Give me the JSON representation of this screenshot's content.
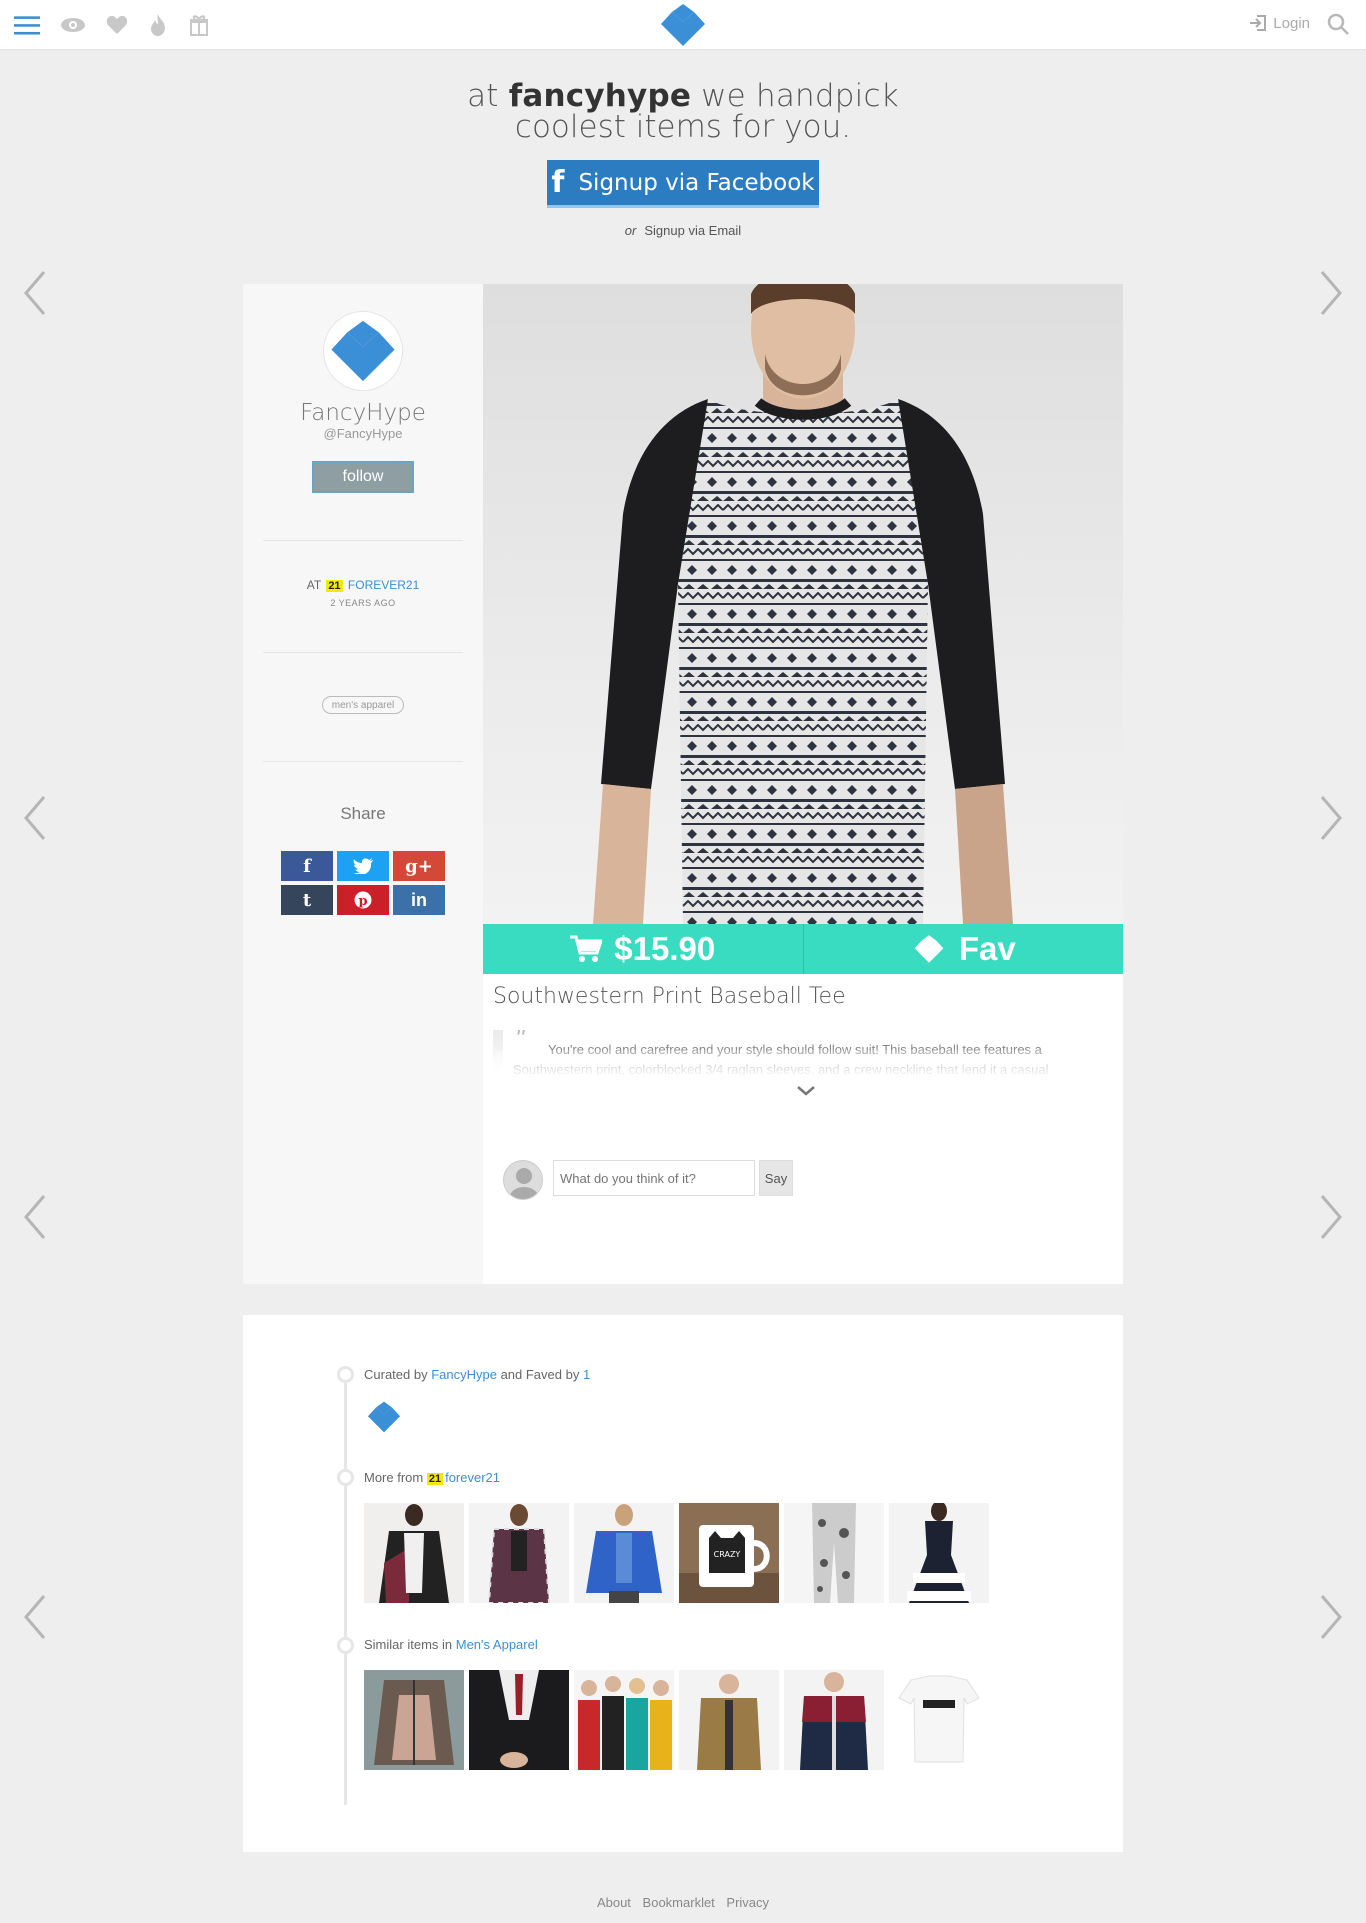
{
  "topbar": {
    "icons": [
      "hamburger-menu-icon",
      "eye-icon",
      "heart-icon",
      "flame-icon",
      "gift-icon"
    ],
    "login_label": "Login"
  },
  "hero": {
    "line1_prefix": "at ",
    "brand": "fancyhype",
    "line1_suffix": " we handpick",
    "line2": "coolest items for you.",
    "facebook_button": "Signup via Facebook",
    "or_label": "or",
    "email_link": "Signup via Email"
  },
  "profile": {
    "name": "FancyHype",
    "handle": "@FancyHype",
    "follow_label": "follow",
    "store_prefix": "AT",
    "store_badge": "21",
    "store_name": "FOREVER21",
    "posted_when": "2 YEARS AGO",
    "tag": "men's apparel",
    "share_label": "Share",
    "share_buttons": [
      {
        "icon": "facebook-icon",
        "glyph": "f",
        "color": "#3b5998"
      },
      {
        "icon": "twitter-icon",
        "glyph": "t",
        "color": "#1da1f2"
      },
      {
        "icon": "google-plus-icon",
        "glyph": "g+",
        "color": "#d34836"
      },
      {
        "icon": "tumblr-icon",
        "glyph": "t",
        "color": "#35465c"
      },
      {
        "icon": "pinterest-icon",
        "glyph": "p",
        "color": "#cb2027"
      },
      {
        "icon": "linkedin-icon",
        "glyph": "in",
        "color": "#3b70a8"
      }
    ]
  },
  "product": {
    "price": "$15.90",
    "fav_label": "Fav",
    "title": "Southwestern Print Baseball Tee",
    "description": "You're cool and carefree and your style should follow suit! This baseball tee features a Southwestern print, colorblocked 3/4 raglan sleeves, and a crew neckline that lend it a casual",
    "accent_color": "#39dcc0"
  },
  "comment": {
    "placeholder": "What do you think of it?",
    "say_label": "Say"
  },
  "related": {
    "curated_prefix": "Curated by ",
    "curated_link": "FancyHype",
    "faved_text": " and Faved by ",
    "faved_count": "1",
    "more_prefix": "More from ",
    "more_badge": "21",
    "more_link": "forever21",
    "similar_prefix": "Similar items in ",
    "similar_link": "Men's Apparel"
  },
  "footer": {
    "links": [
      "About",
      "Bookmarklet",
      "Privacy"
    ]
  }
}
